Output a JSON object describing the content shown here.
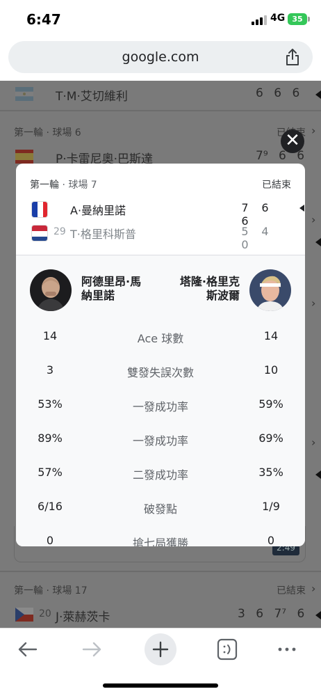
{
  "status_bar": {
    "time": "6:47",
    "network": "4G",
    "battery": "35"
  },
  "browser": {
    "url": "google.com"
  },
  "background": {
    "row1": {
      "name": "T·M·艾切維利",
      "scores": "6 6 6"
    },
    "section1": {
      "round": "第一輪 · 球場 6",
      "status": "已結束"
    },
    "row2": {
      "name": "P·卡雷尼奧·巴斯達",
      "scores": "7⁹ 6 6"
    },
    "section2": {
      "round": "第一輪 · 球場 17",
      "status": "已結束"
    },
    "row3": {
      "seed": "20",
      "name": "J·萊赫茨卡",
      "scores": "3 6 7⁷ 6"
    },
    "video_duration": "2:49"
  },
  "card": {
    "round": "第一輪",
    "court": "· 球場 7",
    "status": "已結束",
    "player1": {
      "name": "A·曼納里諾",
      "sets": [
        "7",
        "6",
        "6"
      ],
      "full_name_line1": "阿德里昂·馬",
      "full_name_line2": "納里諾"
    },
    "player2": {
      "seed": "29",
      "name": "T·格里科斯普",
      "sets": [
        "5",
        "4",
        "0"
      ],
      "full_name_line1": "塔隆·格里克",
      "full_name_line2": "斯波爾"
    },
    "stats": [
      {
        "left": "14",
        "label": "Ace 球數",
        "right": "14"
      },
      {
        "left": "3",
        "label": "雙發失誤次數",
        "right": "10"
      },
      {
        "left": "53%",
        "label": "一發成功率",
        "right": "59%"
      },
      {
        "left": "89%",
        "label": "一發成功率",
        "right": "69%"
      },
      {
        "left": "57%",
        "label": "二發成功率",
        "right": "35%"
      },
      {
        "left": "6/16",
        "label": "破發點",
        "right": "1/9"
      },
      {
        "left": "0",
        "label": "搶七局獲勝",
        "right": "0"
      }
    ]
  },
  "colors": {
    "dim_overlay": "#7a7a7a",
    "card_bg": "#ffffff",
    "stats_bg": "#f8f9fa",
    "battery": "#34c759"
  }
}
